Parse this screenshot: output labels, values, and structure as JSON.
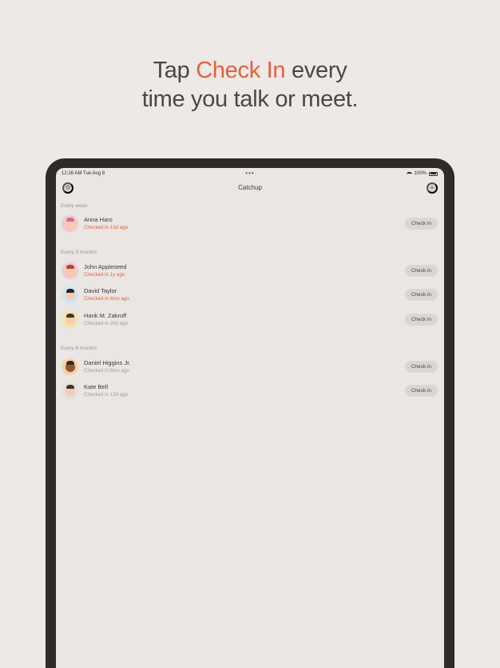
{
  "headline": {
    "prefix": "Tap ",
    "accent": "Check In",
    "suffix": " every",
    "line2": "time you talk or meet."
  },
  "status_bar": {
    "time": "12:16 AM  Tue Aug 8",
    "dots": "•••",
    "battery": "100%"
  },
  "app": {
    "title": "Catchup",
    "settings_icon": "gear-icon",
    "add_icon": "plus-icon"
  },
  "sections": [
    {
      "label": "Every week",
      "contacts": [
        {
          "name": "Anna Haro",
          "status": "Checked in 13d ago",
          "overdue": true,
          "button": "Check in"
        }
      ]
    },
    {
      "label": "Every 3 months",
      "contacts": [
        {
          "name": "John Appleseed",
          "status": "Checked in 1y ago",
          "overdue": true,
          "button": "Check in"
        },
        {
          "name": "David Taylor",
          "status": "Checked in 4mo ago",
          "overdue": true,
          "button": "Check in"
        },
        {
          "name": "Hank M. Zakroff",
          "status": "Checked in 20d ago",
          "overdue": false,
          "button": "Check in"
        }
      ]
    },
    {
      "label": "Every 6 months",
      "contacts": [
        {
          "name": "Daniel Higgins Jr.",
          "status": "Checked in 5mo ago",
          "overdue": false,
          "button": "Check in"
        },
        {
          "name": "Kate Bell",
          "status": "Checked in 12d ago",
          "overdue": false,
          "button": "Check in"
        }
      ]
    }
  ],
  "colors": {
    "accent": "#e8603c",
    "background": "#ece9e6",
    "device": "#2e2b29"
  }
}
